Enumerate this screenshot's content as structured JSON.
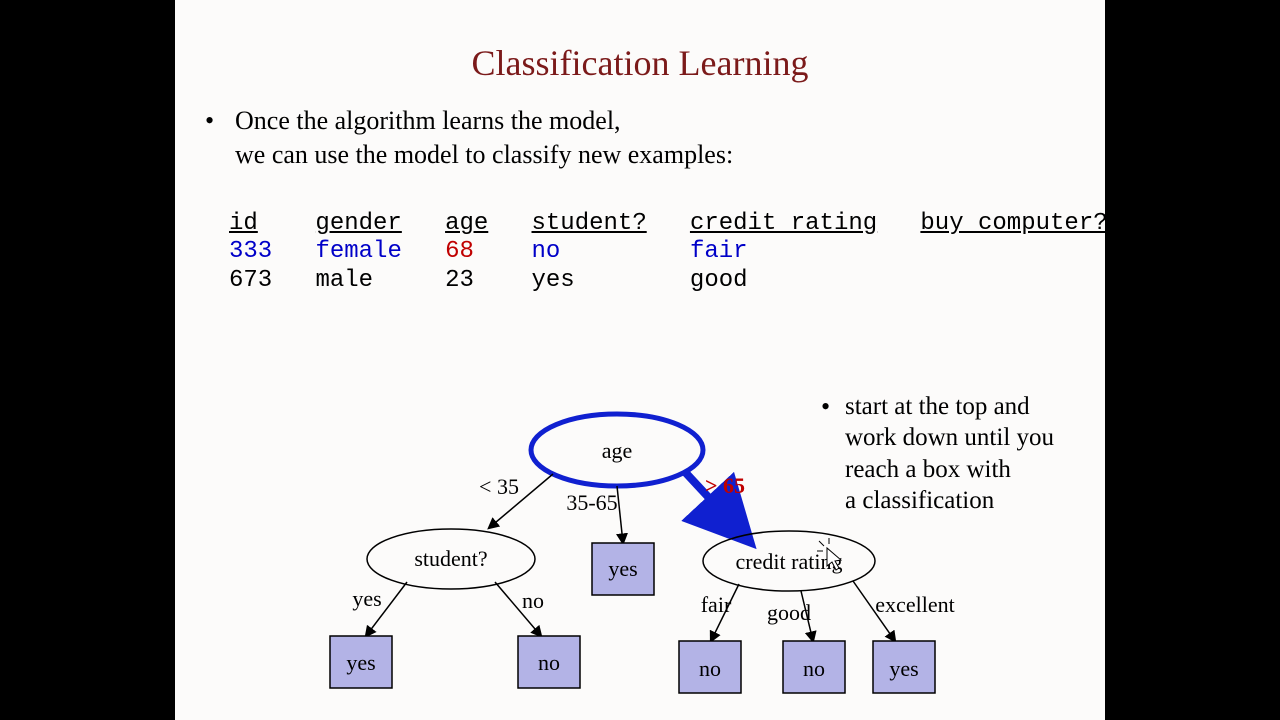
{
  "title": "Classification Learning",
  "bullet": {
    "line1": "Once the algorithm learns the model,",
    "line2": "we can use the model to classify new examples:"
  },
  "table": {
    "headers": {
      "id": "id",
      "gender": "gender",
      "age": "age",
      "student": "student?",
      "credit": "credit rating",
      "buy": "buy computer?"
    },
    "rows": [
      {
        "id": "333",
        "gender": "female",
        "age": "68",
        "student": "no",
        "credit": "fair",
        "buy": ""
      },
      {
        "id": "673",
        "gender": "male",
        "age": "23",
        "student": "yes",
        "credit": "good",
        "buy": ""
      }
    ]
  },
  "side": {
    "line1": "start at the top and",
    "line2": "work down until you",
    "line3": "reach a box with",
    "line4": "a classification"
  },
  "tree": {
    "root": "age",
    "edges": {
      "l": "< 35",
      "m": "35-65",
      "r": "> 65"
    },
    "left": {
      "label": "student?",
      "edges": {
        "l": "yes",
        "r": "no"
      },
      "leaves": {
        "l": "yes",
        "r": "no"
      }
    },
    "mid_leaf": "yes",
    "right": {
      "label": "credit rating",
      "edges": {
        "l": "fair",
        "m": "good",
        "r": "excellent"
      },
      "leaves": {
        "l": "no",
        "m": "no",
        "r": "yes"
      }
    }
  }
}
